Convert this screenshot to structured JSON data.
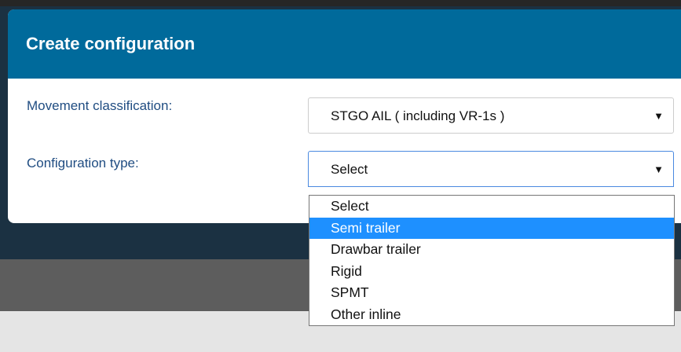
{
  "dialog": {
    "title": "Create configuration"
  },
  "form": {
    "movement_classification": {
      "label": "Movement classification:",
      "selected": "STGO AIL ( including VR-1s )"
    },
    "configuration_type": {
      "label": "Configuration type:",
      "selected": "Select",
      "options": [
        "Select",
        "Semi trailer",
        "Drawbar trailer",
        "Rigid",
        "SPMT",
        "Other inline"
      ],
      "highlighted": "Semi trailer"
    }
  },
  "icons": {
    "dropdown_arrow": "▼"
  },
  "colors": {
    "header_bg": "#006a9b",
    "label_text": "#204d82",
    "highlight_bg": "#1e90ff",
    "focus_border": "#4a89e0"
  }
}
